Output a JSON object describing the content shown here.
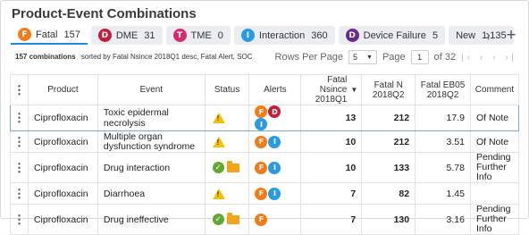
{
  "title": "Product-Event Combinations",
  "tabs": [
    {
      "letter": "F",
      "label": "Fatal",
      "count": "157",
      "color": "#f07d1a"
    },
    {
      "letter": "D",
      "label": "DME",
      "count": "31",
      "color": "#c0213a"
    },
    {
      "letter": "T",
      "label": "TME",
      "count": "0",
      "color": "#d62a6e"
    },
    {
      "letter": "I",
      "label": "Interaction",
      "count": "360",
      "color": "#2a9be0"
    },
    {
      "letter": "D",
      "label": "Device Failure",
      "count": "5",
      "color": "#6a2a8c"
    },
    {
      "letter": "",
      "label": "New",
      "count": "1,135",
      "color": ""
    }
  ],
  "nav": {
    "next_icon": "chevron-right-icon",
    "add_icon": "plus-icon"
  },
  "info": {
    "count": "157 combinations",
    "sort": "sorted by Fatal Nsince 2018Q1 desc, Fatal Alert, SOC"
  },
  "pager": {
    "rows_label": "Rows Per Page",
    "rows_value": "5",
    "page_label": "Page",
    "page_value": "1",
    "of": "of 32"
  },
  "columns": [
    "Product",
    "Event",
    "Status",
    "Alerts",
    "Fatal Nsince 2018Q1",
    "Fatal N 2018Q2",
    "Fatal EB05 2018Q2",
    "Comment"
  ],
  "rows": [
    {
      "product": "Ciprofloxacin",
      "event": "Toxic epidermal necrolysis",
      "status": [
        "warning"
      ],
      "alerts": [
        {
          "l": "F",
          "c": "#f07d1a"
        },
        {
          "l": "D",
          "c": "#c0213a"
        },
        {
          "l": "I",
          "c": "#2a9be0"
        }
      ],
      "n1": "13",
      "n2": "212",
      "eb": "17.9",
      "comment": "Of Note"
    },
    {
      "product": "Ciprofloxacin",
      "event": "Multiple organ dysfunction syndrome",
      "status": [
        "warning"
      ],
      "alerts": [
        {
          "l": "F",
          "c": "#f07d1a"
        },
        {
          "l": "I",
          "c": "#2a9be0"
        }
      ],
      "n1": "10",
      "n2": "212",
      "eb": "3.51",
      "comment": "Of Note"
    },
    {
      "product": "Ciprofloxacin",
      "event": "Drug interaction",
      "status": [
        "check",
        "folder"
      ],
      "alerts": [
        {
          "l": "F",
          "c": "#f07d1a"
        },
        {
          "l": "I",
          "c": "#2a9be0"
        }
      ],
      "n1": "10",
      "n2": "133",
      "eb": "5.78",
      "comment": "Pending Further Info"
    },
    {
      "product": "Ciprofloxacin",
      "event": "Diarrhoea",
      "status": [
        "warning"
      ],
      "alerts": [
        {
          "l": "F",
          "c": "#f07d1a"
        },
        {
          "l": "I",
          "c": "#2a9be0"
        }
      ],
      "n1": "7",
      "n2": "82",
      "eb": "1.45",
      "comment": ""
    },
    {
      "product": "Ciprofloxacin",
      "event": "Drug ineffective",
      "status": [
        "check",
        "folder"
      ],
      "alerts": [
        {
          "l": "F",
          "c": "#f07d1a"
        }
      ],
      "n1": "7",
      "n2": "130",
      "eb": "3.16",
      "comment": "Pending Further Info"
    }
  ]
}
